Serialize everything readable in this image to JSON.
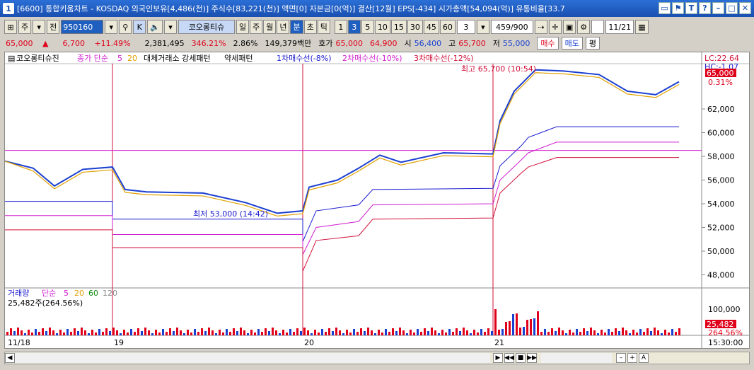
{
  "window": {
    "number": "1",
    "title": "[6600] 통합키움차트 - KOSDAQ 외국인보유[4,486(천)] 주식수[83,221(천)] 액면[0] 자본금[0(억)] 결산[12월] EPS[-434] 시가총액[54,094(억)] 유통비율[33.7",
    "buttons": [
      "▭",
      "⚑",
      "T",
      "?",
      "–",
      "□",
      "✕"
    ]
  },
  "toolbar": {
    "period_select": "주",
    "prev_label": "전",
    "stock_code": "950160",
    "k_label": "K",
    "stock_name": "코오롱티슈",
    "periods": [
      "일",
      "주",
      "월",
      "년",
      "분",
      "초",
      "틱"
    ],
    "active_period": "분",
    "intervals": [
      "1",
      "3",
      "5",
      "10",
      "15",
      "30",
      "45",
      "60"
    ],
    "active_interval": "3",
    "interval_value": "3",
    "count_display": "459/900",
    "date_value": "11/21"
  },
  "quote": {
    "price": "65,000",
    "price_arrow": "▲",
    "change": "6,700",
    "change_pct": "+11.49%",
    "volume": "2,381,495",
    "volume_pct": "346.21%",
    "turnover_pct": "2.86%",
    "amount": "149,379백만",
    "bid_label": "호가",
    "bid": "65,000",
    "ask": "64,900",
    "open_label": "시",
    "open": "56,400",
    "high_label": "고",
    "high": "65,700",
    "low_label": "저",
    "low": "55,000",
    "buy_label": "매수",
    "sell_label": "매도",
    "avg_label": "평"
  },
  "legend": {
    "stock": "코오롱티슈진",
    "ma_label": "종가 단순",
    "ma_5": "5",
    "ma_20": "20",
    "pattern_label": "대체거래소 강세패턴",
    "weak_label": "약세패턴",
    "line1": "1차매수선(-8%)",
    "line2": "2차매수선(-10%)",
    "line3": "3차매수선(-12%)"
  },
  "annotations": {
    "high_label": "최고 65,700 (10:54)",
    "low_label": "최저 53,000 (14:42)",
    "lc": "LC:22.64",
    "hc": "HC:-1.07",
    "current_price_tag": "65,000",
    "current_pct_tag": "0.31%"
  },
  "price_axis": [
    "62,000",
    "60,000",
    "58,000",
    "56,000",
    "54,000",
    "52,000",
    "50,000",
    "48,000"
  ],
  "date_axis": [
    "11/18",
    "19",
    "20",
    "21"
  ],
  "time_label": "15:30:00",
  "volume_panel": {
    "label": "거래량",
    "ma_label": "단순",
    "ma_values": [
      "5",
      "20",
      "60",
      "120"
    ],
    "summary": "25,482주(264.56%)",
    "axis_top": "100,000",
    "current_tag": "25,482",
    "current_pct": "264.56%"
  },
  "colors": {
    "candle_up": "#e0001a",
    "candle_down": "#1a3fd0",
    "ma5": "#d35ad3",
    "ma20": "#e0a000",
    "line1": "#1a1acf",
    "line2": "#d01fd0",
    "line3": "#d0103a"
  }
}
